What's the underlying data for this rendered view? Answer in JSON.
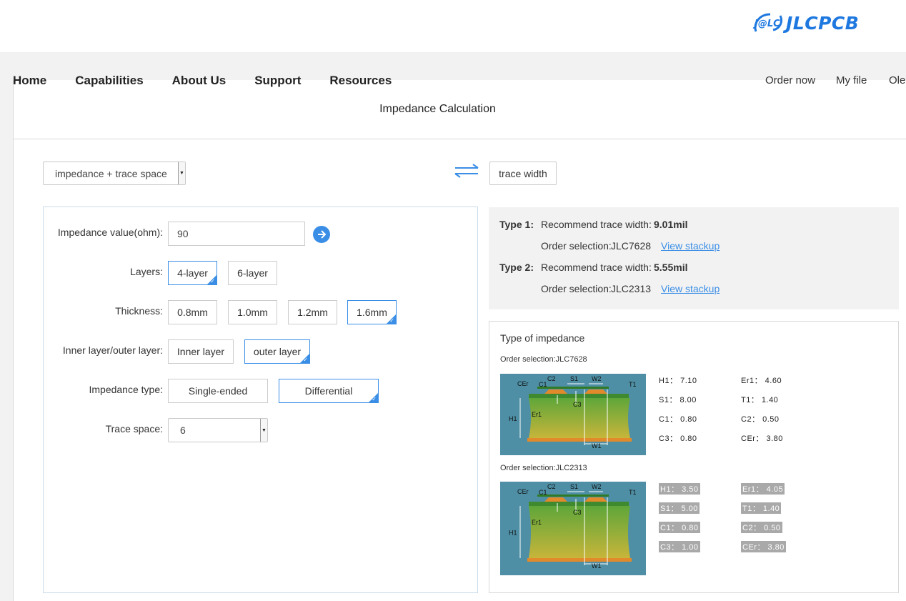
{
  "brand": {
    "logo_mark": "J@LC",
    "name": "JLCPCB",
    "color": "#1e78e0"
  },
  "nav": {
    "items": [
      "Home",
      "Capabilities",
      "About Us",
      "Support",
      "Resources"
    ],
    "right": [
      "Order now",
      "My file",
      "Oleg"
    ]
  },
  "page_title": "Impedance Calculation",
  "mode": {
    "selected": "impedance + trace space",
    "swap_icon": "swap-arrows-icon",
    "alternate": "trace width"
  },
  "form": {
    "impedance_label": "Impedance value(ohm):",
    "impedance_value": "90",
    "layers_label": "Layers:",
    "layers": [
      {
        "label": "4-layer",
        "selected": true
      },
      {
        "label": "6-layer",
        "selected": false
      }
    ],
    "thickness_label": "Thickness:",
    "thickness": [
      {
        "label": "0.8mm",
        "selected": false
      },
      {
        "label": "1.0mm",
        "selected": false
      },
      {
        "label": "1.2mm",
        "selected": false
      },
      {
        "label": "1.6mm",
        "selected": true
      }
    ],
    "layer_pos_label": "Inner layer/outer layer:",
    "layer_pos": [
      {
        "label": "Inner layer",
        "selected": false
      },
      {
        "label": "outer layer",
        "selected": true
      }
    ],
    "imp_type_label": "Impedance type:",
    "imp_type": [
      {
        "label": "Single-ended",
        "selected": false
      },
      {
        "label": "Differential",
        "selected": true
      }
    ],
    "trace_space_label": "Trace space:",
    "trace_space_value": "6",
    "tick": "✓"
  },
  "results": [
    {
      "type_label": "Type 1:",
      "recommend_label": "Recommend trace width:",
      "recommend_value": "9.01mil",
      "order_label": "Order selection:",
      "order_value": "JLC7628",
      "link": "View stackup"
    },
    {
      "type_label": "Type 2:",
      "recommend_label": "Recommend trace width:",
      "recommend_value": "5.55mil",
      "order_label": "Order selection:",
      "order_value": "JLC2313",
      "link": "View stackup"
    }
  ],
  "impedance_types": {
    "title": "Type of impedance",
    "stackups": [
      {
        "order": "Order selection:JLC7628",
        "params": [
          {
            "k": "H1",
            "v": "7.10"
          },
          {
            "k": "Er1",
            "v": "4.60"
          },
          {
            "k": "S1",
            "v": "8.00"
          },
          {
            "k": "T1",
            "v": "1.40"
          },
          {
            "k": "C1",
            "v": "0.80"
          },
          {
            "k": "C2",
            "v": "0.50"
          },
          {
            "k": "C3",
            "v": "0.80"
          },
          {
            "k": "CEr",
            "v": "3.80"
          }
        ],
        "highlighted": false
      },
      {
        "order": "Order selection:JLC2313",
        "params": [
          {
            "k": "H1",
            "v": "3.50"
          },
          {
            "k": "Er1",
            "v": "4.05"
          },
          {
            "k": "S1",
            "v": "5.00"
          },
          {
            "k": "T1",
            "v": "1.40"
          },
          {
            "k": "C1",
            "v": "0.80"
          },
          {
            "k": "C2",
            "v": "0.50"
          },
          {
            "k": "C3",
            "v": "1.00"
          },
          {
            "k": "CEr",
            "v": "3.80"
          }
        ],
        "highlighted": true
      }
    ],
    "diagram_labels": {
      "cer": "CEr",
      "c1": "C1",
      "c2": "C2",
      "s1": "S1",
      "w2": "W2",
      "t1": "T1",
      "c3": "C3",
      "h1": "H1",
      "er1": "Er1",
      "w1": "W1"
    },
    "separator": "："
  },
  "colors": {
    "accent": "#3a8ee6",
    "pcb_bg": "#4e8fa5",
    "pcb_board": "#6fae3f",
    "copper": "#e08a2b"
  }
}
